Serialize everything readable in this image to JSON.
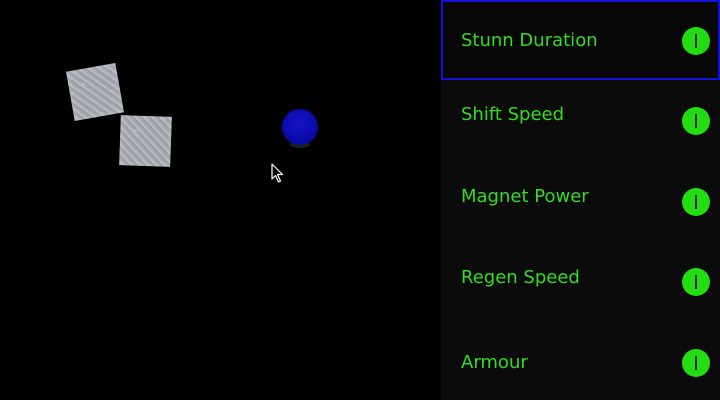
{
  "colors": {
    "background": "#000000",
    "panel": "#0b0b0b",
    "label_green": "#33dd22",
    "button_green": "#22dd11",
    "selection_border": "#1212d8",
    "player_blue": "#0a0aa8",
    "crate_gray": "#a6aab0"
  },
  "game": {
    "crates": [
      "metal-crate",
      "metal-crate"
    ],
    "player": "blue-ball",
    "cursor": "mouse-pointer-icon"
  },
  "upgrades": [
    {
      "label": "Stunn Duration",
      "selected": true,
      "button_icon": "level-bar-icon"
    },
    {
      "label": "Shift Speed",
      "selected": false,
      "button_icon": "level-bar-icon"
    },
    {
      "label": "Magnet Power",
      "selected": false,
      "button_icon": "level-bar-icon"
    },
    {
      "label": "Regen Speed",
      "selected": false,
      "button_icon": "level-bar-icon"
    },
    {
      "label": "Armour",
      "selected": false,
      "button_icon": "level-bar-icon"
    }
  ]
}
